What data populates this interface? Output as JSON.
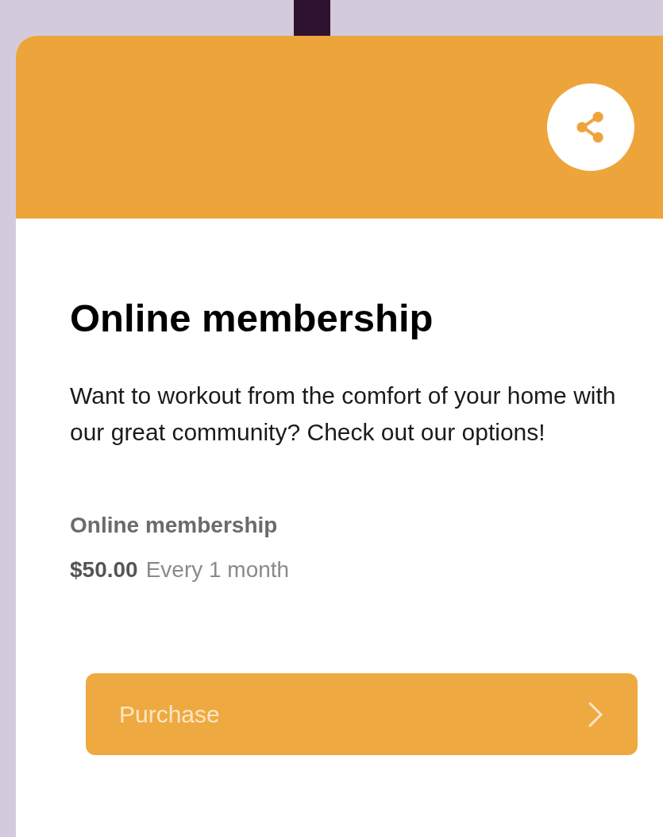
{
  "card": {
    "title": "Online membership",
    "description": "Want to workout from the comfort of your home with our great community? Check out our options!",
    "plan": {
      "name": "Online membership",
      "price": "$50.00",
      "period": "Every 1 month"
    },
    "button": {
      "label": "Purchase"
    }
  }
}
